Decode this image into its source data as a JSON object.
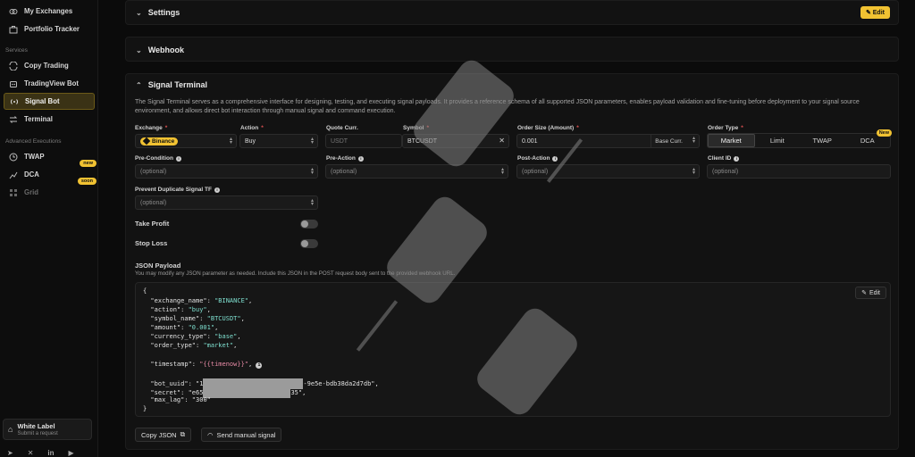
{
  "sidebar": {
    "top_items": [
      {
        "label": "My Exchanges",
        "icon": "exchanges-icon"
      },
      {
        "label": "Portfolio Tracker",
        "icon": "portfolio-icon"
      }
    ],
    "services_label": "Services",
    "services": [
      {
        "label": "Copy Trading",
        "icon": "copy-trading-icon"
      },
      {
        "label": "TradingView Bot",
        "icon": "tradingview-icon"
      },
      {
        "label": "Signal Bot",
        "icon": "signal-icon",
        "active": true
      },
      {
        "label": "Terminal",
        "icon": "terminal-icon"
      }
    ],
    "advanced_label": "Advanced Executions",
    "advanced": [
      {
        "label": "TWAP",
        "icon": "twap-icon"
      },
      {
        "label": "DCA",
        "icon": "dca-icon",
        "badge": "new"
      },
      {
        "label": "Grid",
        "icon": "grid-icon",
        "badge": "soon"
      }
    ],
    "white_label": {
      "title": "White Label",
      "subtitle": "Submit a request"
    }
  },
  "settings": {
    "title": "Settings",
    "edit_label": "Edit"
  },
  "webhook": {
    "title": "Webhook"
  },
  "terminal": {
    "title": "Signal Terminal",
    "description": "The Signal Terminal serves as a comprehensive interface for designing, testing, and executing signal payloads. It provides a reference schema of all supported JSON parameters, enables payload validation and fine-tuning before deployment to your signal source environment, and allows direct bot interaction through manual signal and command execution.",
    "exchange": {
      "label": "Exchange",
      "value": "Binance"
    },
    "action": {
      "label": "Action",
      "value": "Buy"
    },
    "quote": {
      "label": "Quote Curr.",
      "value": "USDT"
    },
    "symbol": {
      "label": "Symbol",
      "value": "BTCUSDT"
    },
    "order_size": {
      "label": "Order Size (Amount)",
      "value": "0.001",
      "unit": "Base Curr."
    },
    "order_type": {
      "label": "Order Type",
      "options": [
        "Market",
        "Limit",
        "TWAP",
        "DCA"
      ],
      "selected": "Market",
      "badge": "New"
    },
    "pre_condition": {
      "label": "Pre-Condition",
      "placeholder": "(optional)"
    },
    "pre_action": {
      "label": "Pre-Action",
      "placeholder": "(optional)"
    },
    "post_action": {
      "label": "Post-Action",
      "placeholder": "(optional)"
    },
    "client_id": {
      "label": "Client ID",
      "placeholder": "(optional)"
    },
    "prevent_dup": {
      "label": "Prevent Duplicate Signal TF",
      "placeholder": "(optional)"
    },
    "take_profit": {
      "label": "Take Profit"
    },
    "stop_loss": {
      "label": "Stop Loss"
    },
    "json": {
      "title": "JSON Payload",
      "subtitle": "You may modify any JSON parameter as needed. Include this JSON in the POST request body sent to the provided webhook URL.",
      "edit_label": "Edit",
      "exchange_name": "\"BINANCE\"",
      "action": "\"buy\"",
      "symbol_name": "\"BTCUSDT\"",
      "amount": "\"0.001\"",
      "currency_type": "\"base\"",
      "order_type": "\"market\"",
      "timestamp": "\"{{timenow}}\"",
      "bot_uuid_start": "\"1",
      "bot_uuid_end": "-9e5e-bdb38da2d7db\"",
      "secret_start": "\"e65",
      "secret_end": "35\"",
      "max_lag": "\"300\""
    },
    "copy_json_label": "Copy JSON",
    "send_manual_label": "Send manual signal"
  }
}
